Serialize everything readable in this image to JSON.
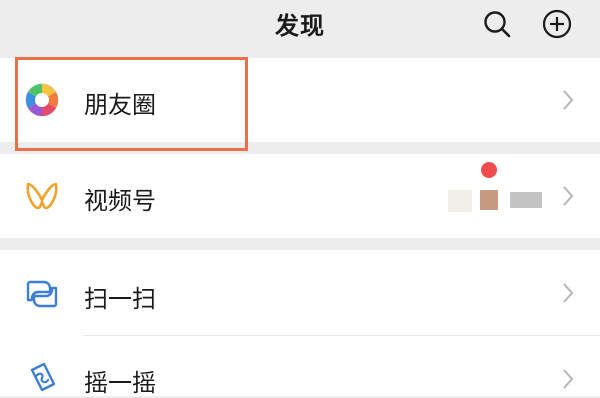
{
  "header": {
    "title": "发现",
    "search_icon": "search-icon",
    "add_icon": "plus-circle-icon"
  },
  "items": [
    {
      "label": "朋友圈",
      "icon": "moments-shutter-icon",
      "chevron": "chevron-right-icon"
    },
    {
      "label": "视频号",
      "icon": "channels-butterfly-icon",
      "chevron": "chevron-right-icon"
    },
    {
      "label": "扫一扫",
      "icon": "scan-icon",
      "chevron": "chevron-right-icon"
    },
    {
      "label": "摇一摇",
      "icon": "shake-icon",
      "chevron": "chevron-right-icon"
    }
  ],
  "colors": {
    "background": "#ededed",
    "highlight": "#e8704a",
    "scan_icon": "#3d7fd4",
    "channels_icon": "#f0a42a",
    "badge": "#ee4c4c"
  }
}
